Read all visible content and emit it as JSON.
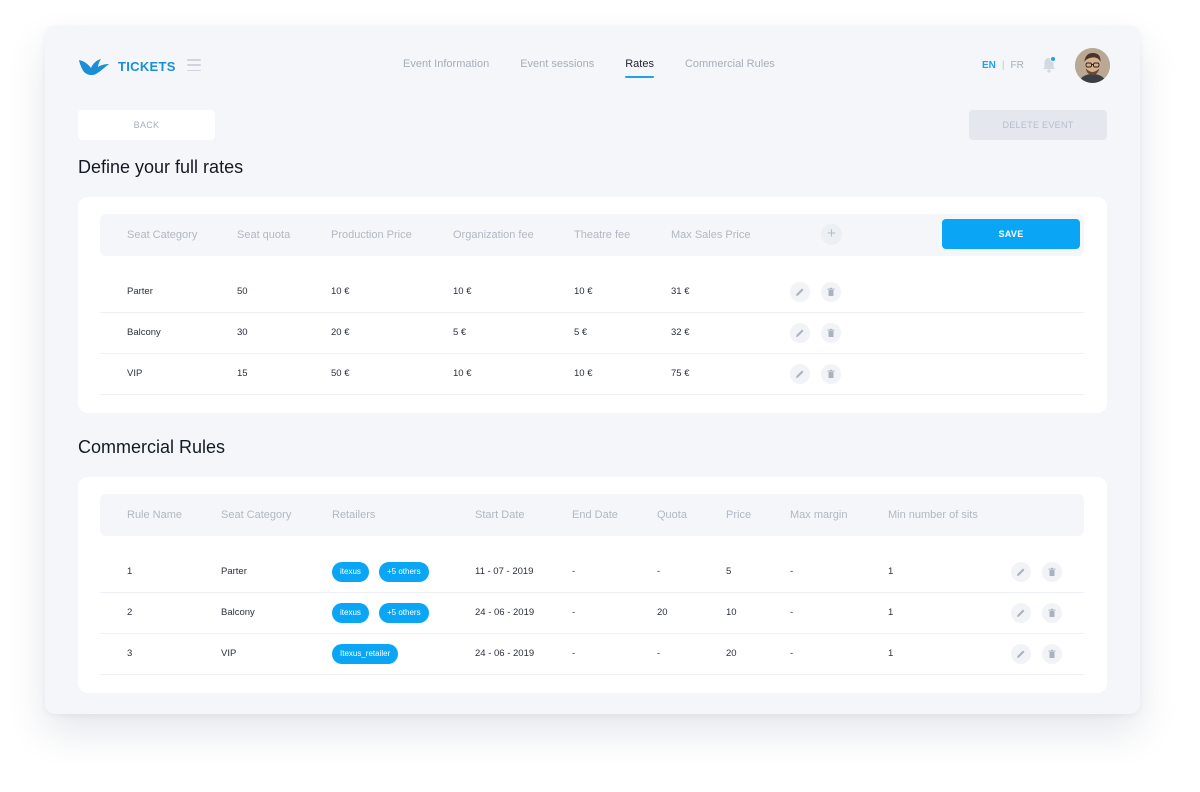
{
  "header": {
    "logo_text": "TICKETS",
    "tabs": [
      "Event Information",
      "Event sessions",
      "Rates",
      "Commercial Rules"
    ],
    "active_tab": "Rates",
    "lang_en": "EN",
    "lang_sep": "|",
    "lang_fr": "FR"
  },
  "colors": {
    "accent": "#0aa6f5",
    "brand": "#1a8fd8"
  },
  "actions": {
    "back_label": "BACK",
    "delete_label": "DELETE EVENT",
    "save_label": "SAVE",
    "add_symbol": "+"
  },
  "rates": {
    "title": "Define your full rates",
    "columns": [
      "Seat Category",
      "Seat quota",
      "Production Price",
      "Organization fee",
      "Theatre fee",
      "Max Sales Price"
    ],
    "rows": [
      [
        "Parter",
        "50",
        "10 €",
        "10 €",
        "10 €",
        "31 €"
      ],
      [
        "Balcony",
        "30",
        "20 €",
        "5 €",
        "5 €",
        "32 €"
      ],
      [
        "VIP",
        "15",
        "50 €",
        "10 €",
        "10 €",
        "75 €"
      ]
    ]
  },
  "commercial": {
    "title": "Commercial Rules",
    "columns": [
      "Rule Name",
      "Seat Category",
      "Retailers",
      "Start Date",
      "End Date",
      "Quota",
      "Price",
      "Max margin",
      "Min number of sits"
    ],
    "rows": [
      {
        "rule": "1",
        "category": "Parter",
        "retailers": [
          "itexus",
          "+5 others"
        ],
        "start": "11 - 07 - 2019",
        "end": "-",
        "quota": "-",
        "price": "5",
        "margin": "-",
        "min": "1"
      },
      {
        "rule": "2",
        "category": "Balcony",
        "retailers": [
          "itexus",
          "+5 others"
        ],
        "start": "24 - 06 - 2019",
        "end": "-",
        "quota": "20",
        "price": "10",
        "margin": "-",
        "min": "1"
      },
      {
        "rule": "3",
        "category": "VIP",
        "retailers": [
          "Itexus_retailer"
        ],
        "start": "24 - 06 - 2019",
        "end": "-",
        "quota": "-",
        "price": "20",
        "margin": "-",
        "min": "1"
      }
    ]
  }
}
